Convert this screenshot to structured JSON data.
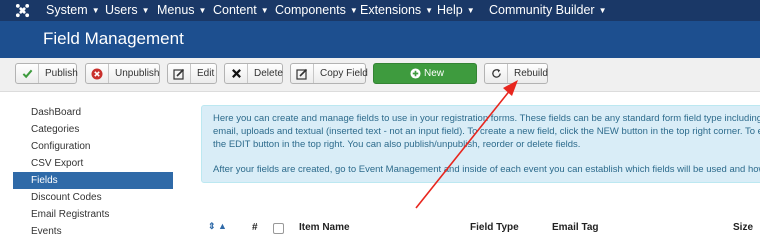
{
  "topnav": {
    "menus": [
      {
        "label": "System"
      },
      {
        "label": "Users"
      },
      {
        "label": "Menus"
      },
      {
        "label": "Content"
      },
      {
        "label": "Components"
      },
      {
        "label": "Extensions"
      },
      {
        "label": "Help"
      },
      {
        "label": "Community Builder"
      }
    ]
  },
  "header": {
    "title": "Field Management"
  },
  "toolbar": {
    "publish": "Publish",
    "unpublish": "Unpublish",
    "edit": "Edit",
    "delete": "Delete",
    "copy_field": "Copy Field",
    "new": "New",
    "rebuild": "Rebuild"
  },
  "sidebar": {
    "items": [
      {
        "label": "DashBoard"
      },
      {
        "label": "Categories"
      },
      {
        "label": "Configuration"
      },
      {
        "label": "CSV Export"
      },
      {
        "label": "Fields"
      },
      {
        "label": "Discount Codes"
      },
      {
        "label": "Email Registrants"
      },
      {
        "label": "Events"
      }
    ]
  },
  "info": {
    "line1": "Here you can create and manage fields to use in your registration forms. These fields can be any standard form field type including: te",
    "line2": "email, uploads and textual (inserted text - not an input field). To create a new field, click the NEW button in the top right corner. To edit",
    "line3": "the EDIT button in the top right. You can also publish/unpublish, reorder or delete fields.",
    "line4": "After your fields are created, go to Event Management and inside of each event you can establish which fields will be used and how to"
  },
  "table": {
    "columns": {
      "number": "#",
      "item_name": "Item Name",
      "field_type": "Field Type",
      "email_tag": "Email Tag",
      "size": "Size"
    }
  },
  "colors": {
    "topnav_bg": "#1a3867",
    "header_bg": "#1d4f8f",
    "new_button": "#3e9b3e",
    "sidebar_active": "#2f6aa8",
    "info_bg": "#d9edf7",
    "annotation_arrow": "#e8261e"
  }
}
